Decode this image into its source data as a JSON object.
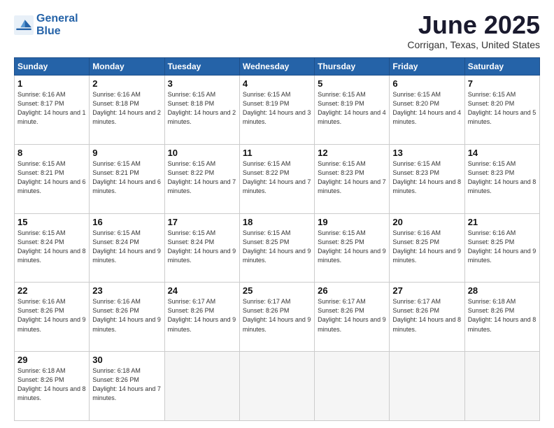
{
  "logo": {
    "line1": "General",
    "line2": "Blue"
  },
  "title": "June 2025",
  "location": "Corrigan, Texas, United States",
  "days_header": [
    "Sunday",
    "Monday",
    "Tuesday",
    "Wednesday",
    "Thursday",
    "Friday",
    "Saturday"
  ],
  "weeks": [
    [
      {
        "day": "1",
        "sunrise": "6:16 AM",
        "sunset": "8:17 PM",
        "daylight": "14 hours and 1 minute."
      },
      {
        "day": "2",
        "sunrise": "6:16 AM",
        "sunset": "8:18 PM",
        "daylight": "14 hours and 2 minutes."
      },
      {
        "day": "3",
        "sunrise": "6:15 AM",
        "sunset": "8:18 PM",
        "daylight": "14 hours and 2 minutes."
      },
      {
        "day": "4",
        "sunrise": "6:15 AM",
        "sunset": "8:19 PM",
        "daylight": "14 hours and 3 minutes."
      },
      {
        "day": "5",
        "sunrise": "6:15 AM",
        "sunset": "8:19 PM",
        "daylight": "14 hours and 4 minutes."
      },
      {
        "day": "6",
        "sunrise": "6:15 AM",
        "sunset": "8:20 PM",
        "daylight": "14 hours and 4 minutes."
      },
      {
        "day": "7",
        "sunrise": "6:15 AM",
        "sunset": "8:20 PM",
        "daylight": "14 hours and 5 minutes."
      }
    ],
    [
      {
        "day": "8",
        "sunrise": "6:15 AM",
        "sunset": "8:21 PM",
        "daylight": "14 hours and 6 minutes."
      },
      {
        "day": "9",
        "sunrise": "6:15 AM",
        "sunset": "8:21 PM",
        "daylight": "14 hours and 6 minutes."
      },
      {
        "day": "10",
        "sunrise": "6:15 AM",
        "sunset": "8:22 PM",
        "daylight": "14 hours and 7 minutes."
      },
      {
        "day": "11",
        "sunrise": "6:15 AM",
        "sunset": "8:22 PM",
        "daylight": "14 hours and 7 minutes."
      },
      {
        "day": "12",
        "sunrise": "6:15 AM",
        "sunset": "8:23 PM",
        "daylight": "14 hours and 7 minutes."
      },
      {
        "day": "13",
        "sunrise": "6:15 AM",
        "sunset": "8:23 PM",
        "daylight": "14 hours and 8 minutes."
      },
      {
        "day": "14",
        "sunrise": "6:15 AM",
        "sunset": "8:23 PM",
        "daylight": "14 hours and 8 minutes."
      }
    ],
    [
      {
        "day": "15",
        "sunrise": "6:15 AM",
        "sunset": "8:24 PM",
        "daylight": "14 hours and 8 minutes."
      },
      {
        "day": "16",
        "sunrise": "6:15 AM",
        "sunset": "8:24 PM",
        "daylight": "14 hours and 9 minutes."
      },
      {
        "day": "17",
        "sunrise": "6:15 AM",
        "sunset": "8:24 PM",
        "daylight": "14 hours and 9 minutes."
      },
      {
        "day": "18",
        "sunrise": "6:15 AM",
        "sunset": "8:25 PM",
        "daylight": "14 hours and 9 minutes."
      },
      {
        "day": "19",
        "sunrise": "6:15 AM",
        "sunset": "8:25 PM",
        "daylight": "14 hours and 9 minutes."
      },
      {
        "day": "20",
        "sunrise": "6:16 AM",
        "sunset": "8:25 PM",
        "daylight": "14 hours and 9 minutes."
      },
      {
        "day": "21",
        "sunrise": "6:16 AM",
        "sunset": "8:25 PM",
        "daylight": "14 hours and 9 minutes."
      }
    ],
    [
      {
        "day": "22",
        "sunrise": "6:16 AM",
        "sunset": "8:26 PM",
        "daylight": "14 hours and 9 minutes."
      },
      {
        "day": "23",
        "sunrise": "6:16 AM",
        "sunset": "8:26 PM",
        "daylight": "14 hours and 9 minutes."
      },
      {
        "day": "24",
        "sunrise": "6:17 AM",
        "sunset": "8:26 PM",
        "daylight": "14 hours and 9 minutes."
      },
      {
        "day": "25",
        "sunrise": "6:17 AM",
        "sunset": "8:26 PM",
        "daylight": "14 hours and 9 minutes."
      },
      {
        "day": "26",
        "sunrise": "6:17 AM",
        "sunset": "8:26 PM",
        "daylight": "14 hours and 9 minutes."
      },
      {
        "day": "27",
        "sunrise": "6:17 AM",
        "sunset": "8:26 PM",
        "daylight": "14 hours and 8 minutes."
      },
      {
        "day": "28",
        "sunrise": "6:18 AM",
        "sunset": "8:26 PM",
        "daylight": "14 hours and 8 minutes."
      }
    ],
    [
      {
        "day": "29",
        "sunrise": "6:18 AM",
        "sunset": "8:26 PM",
        "daylight": "14 hours and 8 minutes."
      },
      {
        "day": "30",
        "sunrise": "6:18 AM",
        "sunset": "8:26 PM",
        "daylight": "14 hours and 7 minutes."
      },
      null,
      null,
      null,
      null,
      null
    ]
  ]
}
